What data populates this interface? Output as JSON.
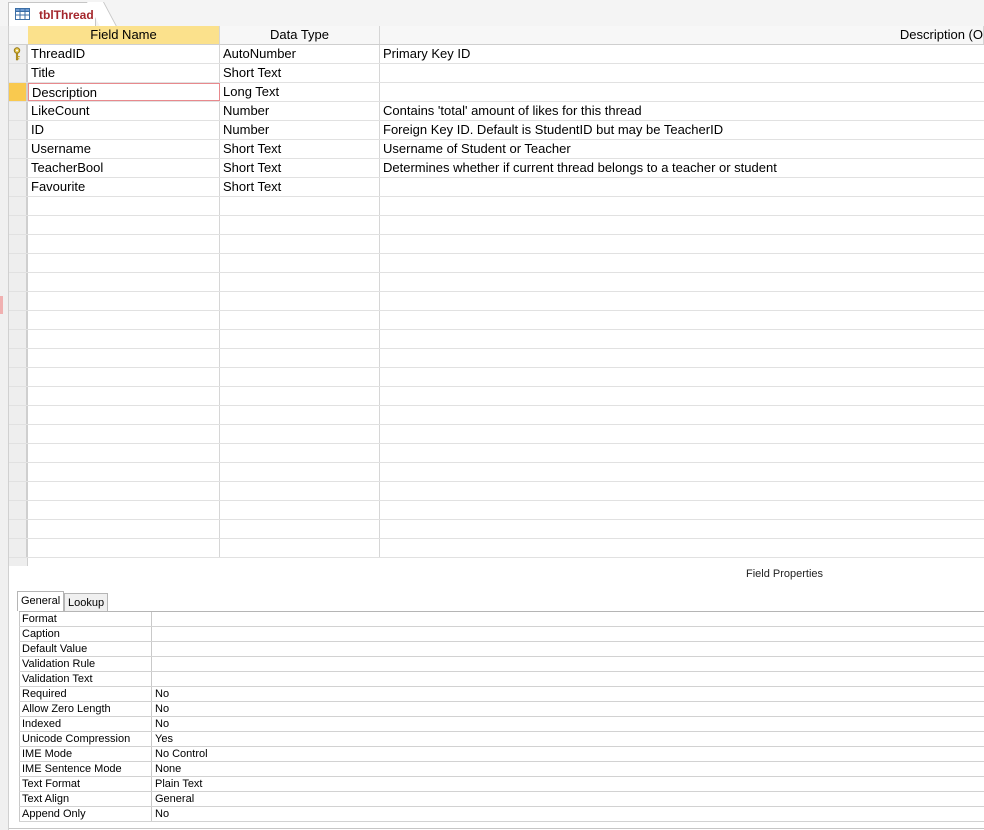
{
  "tab": {
    "title": "tblThread",
    "icon": "table-icon"
  },
  "grid": {
    "headers": {
      "field_name": "Field Name",
      "data_type": "Data Type",
      "description": "Description (O"
    },
    "rows": [
      {
        "field": "ThreadID",
        "type": "AutoNumber",
        "description": "Primary Key ID",
        "primary_key": true
      },
      {
        "field": "Title",
        "type": "Short Text",
        "description": ""
      },
      {
        "field": "Description",
        "type": "Long Text",
        "description": "",
        "selected": true
      },
      {
        "field": "LikeCount",
        "type": "Number",
        "description": "Contains 'total' amount of likes for this thread"
      },
      {
        "field": "ID",
        "type": "Number",
        "description": "Foreign Key ID. Default is StudentID but may be TeacherID"
      },
      {
        "field": "Username",
        "type": "Short Text",
        "description": "Username of Student or Teacher"
      },
      {
        "field": "TeacherBool",
        "type": "Short Text",
        "description": "Determines whether if current thread belongs to a teacher or student"
      },
      {
        "field": "Favourite",
        "type": "Short Text",
        "description": ""
      }
    ],
    "empty_row_count": 19
  },
  "field_properties": {
    "title": "Field Properties",
    "tabs": {
      "general": "General",
      "lookup": "Lookup"
    },
    "properties": [
      {
        "label": "Format",
        "value": ""
      },
      {
        "label": "Caption",
        "value": ""
      },
      {
        "label": "Default Value",
        "value": ""
      },
      {
        "label": "Validation Rule",
        "value": ""
      },
      {
        "label": "Validation Text",
        "value": ""
      },
      {
        "label": "Required",
        "value": "No"
      },
      {
        "label": "Allow Zero Length",
        "value": "No"
      },
      {
        "label": "Indexed",
        "value": "No"
      },
      {
        "label": "Unicode Compression",
        "value": "Yes"
      },
      {
        "label": "IME Mode",
        "value": "No Control"
      },
      {
        "label": "IME Sentence Mode",
        "value": "None"
      },
      {
        "label": "Text Format",
        "value": "Plain Text"
      },
      {
        "label": "Text Align",
        "value": "General"
      },
      {
        "label": "Append Only",
        "value": "No"
      }
    ]
  },
  "colors": {
    "header_active": "#fbe18c",
    "row_selector_active": "#f9c94f",
    "tab_text": "#a4262c",
    "focus_border": "#e8898d"
  }
}
